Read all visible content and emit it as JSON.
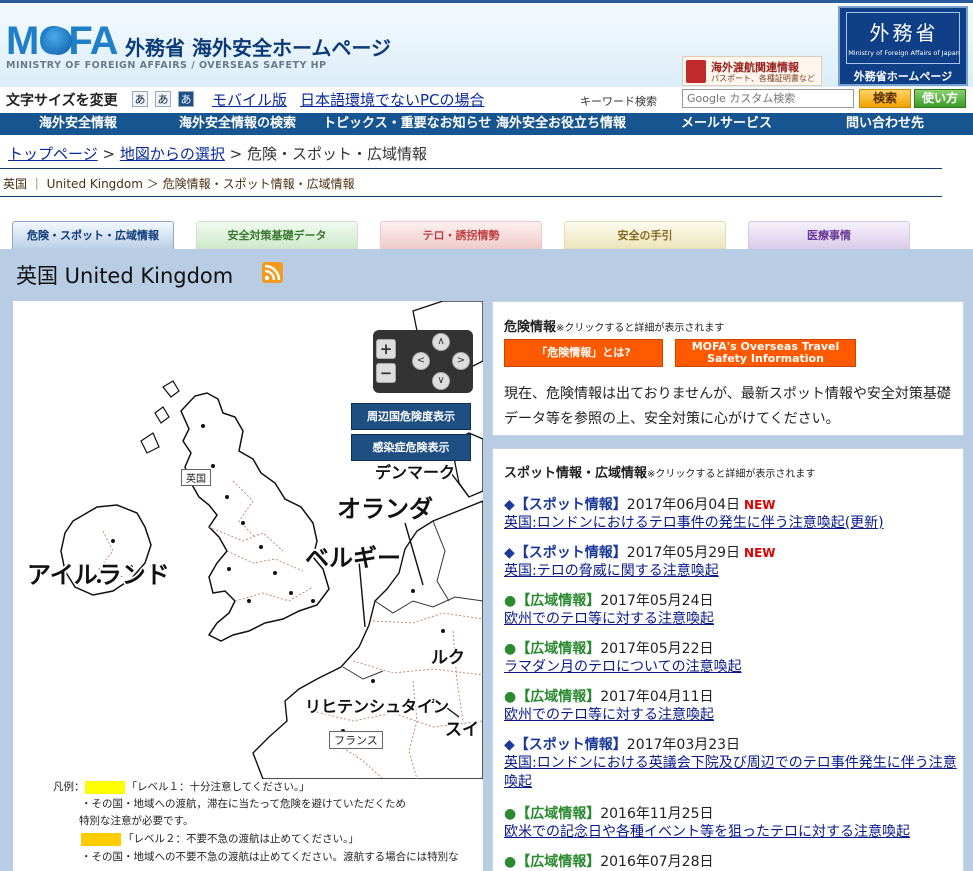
{
  "header": {
    "logo": "MOFA",
    "title": "外務省 海外安全ホームページ",
    "subtitle": "MINISTRY OF FOREIGN AFFAIRS / OVERSEAS SAFETY HP",
    "passport_title": "海外渡航関連情報",
    "passport_sub": "パスポート、各種証明書など",
    "mofa_kanji": "外務省",
    "mofa_en": "Ministry of Foreign Affairs of Japan",
    "mofa_home": "外務省ホームページ"
  },
  "util": {
    "font_size_label": "文字サイズを変更",
    "fs_small": "あ",
    "fs_medium": "あ",
    "fs_large": "あ",
    "mobile": "モバイル版",
    "non_japanese": "日本語環境でないPCの場合",
    "keyword_label": "キーワード検索",
    "search_placeholder": "Google カスタム検索",
    "search_button": "検索",
    "howto_button": "使い方"
  },
  "nav": [
    "海外安全情報",
    "海外安全情報の検索",
    "トピックス・重要なお知らせ",
    "海外安全お役立ち情報",
    "メールサービス",
    "問い合わせ先"
  ],
  "breadcrumb": {
    "top": "トップページ",
    "sep1": " > ",
    "map": "地図からの選択",
    "sep2": " > ",
    "current": "危険・スポット・広域情報",
    "sub": "英国 ｜ United Kingdom ＞ 危険情報・スポット情報・広域情報"
  },
  "tabs": {
    "danger": "危険・スポット・広域情報",
    "basic": "安全対策基礎データ",
    "terror": "テロ・誘拐情勢",
    "guide": "安全の手引",
    "medical": "医療事情"
  },
  "country_title": "英国 United Kingdom",
  "map": {
    "btn_neighbor": "周辺国危険度表示",
    "btn_infection": "感染症危険表示",
    "zoom_in": "+",
    "zoom_out": "−",
    "labels": {
      "uk": "英国",
      "ireland": "アイルランド",
      "netherlands": "オランダ",
      "belgium": "ベルギー",
      "denmark": "デンマーク",
      "liechtenstein": "リヒテンシュタイン",
      "france": "フランス",
      "lux_fragment": "ルク",
      "swiss_fragment": "スイ"
    }
  },
  "legend": {
    "prefix": "凡例：",
    "l1": "「レベル１：十分注意してください。」",
    "l1_desc1": "・その国・地域への渡航，滞在に当たって危険を避けていただくため",
    "l1_desc2": "特別な注意が必要です。",
    "l2": "「レベル２：不要不急の渡航は止めてください。」",
    "l2_desc1": "・その国・地域への不要不急の渡航は止めてください。渡航する場合には特別な",
    "level1_color": "#ffff00",
    "level2_color": "#ffcc00"
  },
  "danger": {
    "title": "危険情報",
    "note": "※クリックすると詳細が表示されます",
    "btn_what": "「危険情報」とは?",
    "btn_en": "MOFA's Overseas Travel Safety Information",
    "text": "現在、危険情報は出ておりませんが、最新スポット情報や安全対策基礎データ等を参照の上、安全対策に心がけてください。"
  },
  "spot": {
    "title": "スポット情報・広域情報",
    "note": "※クリックすると詳細が表示されます",
    "items": [
      {
        "marker": "◆",
        "cat": "【スポット情報】",
        "date": "2017年06月04日",
        "new": "NEW",
        "title": "英国:ロンドンにおけるテロ事件の発生に伴う注意喚起(更新)"
      },
      {
        "marker": "◆",
        "cat": "【スポット情報】",
        "date": "2017年05月29日",
        "new": "NEW",
        "title": "英国:テロの脅威に関する注意喚起"
      },
      {
        "marker": "●",
        "cat": "【広域情報】",
        "date": "2017年05月24日",
        "new": "",
        "title": "欧州でのテロ等に対する注意喚起"
      },
      {
        "marker": "●",
        "cat": "【広域情報】",
        "date": "2017年05月22日",
        "new": "",
        "title": "ラマダン月のテロについての注意喚起"
      },
      {
        "marker": "●",
        "cat": "【広域情報】",
        "date": "2017年04月11日",
        "new": "",
        "title": "欧州でのテロ等に対する注意喚起"
      },
      {
        "marker": "◆",
        "cat": "【スポット情報】",
        "date": "2017年03月23日",
        "new": "",
        "title": "英国:ロンドンにおける英議会下院及び周辺でのテロ事件発生に伴う注意喚起"
      },
      {
        "marker": "●",
        "cat": "【広域情報】",
        "date": "2016年11月25日",
        "new": "",
        "title": "欧米での記念日や各種イベント等を狙ったテロに対する注意喚起"
      },
      {
        "marker": "●",
        "cat": "【広域情報】",
        "date": "2016年07月28日",
        "new": "",
        "title": ""
      }
    ]
  },
  "colors": {
    "navy": "#16558f",
    "orange": "#ff5a00",
    "content_bg": "#b8cce4",
    "spot_blue": "#1a3a9a",
    "area_green": "#2a8a30",
    "new_red": "#e00000"
  }
}
